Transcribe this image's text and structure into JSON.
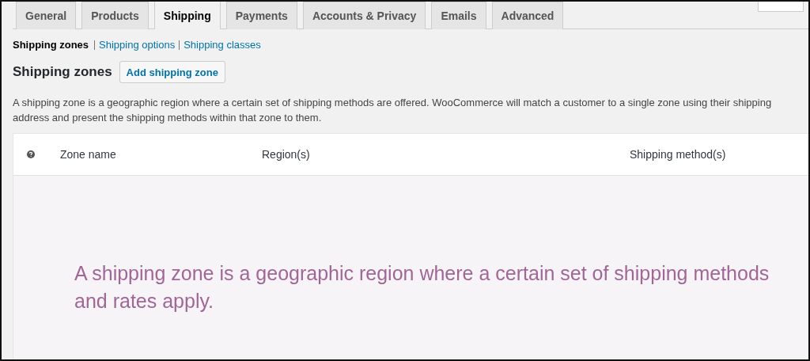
{
  "tabs": [
    {
      "label": "General",
      "selected": false
    },
    {
      "label": "Products",
      "selected": false
    },
    {
      "label": "Shipping",
      "selected": true
    },
    {
      "label": "Payments",
      "selected": false
    },
    {
      "label": "Accounts & Privacy",
      "selected": false
    },
    {
      "label": "Emails",
      "selected": false
    },
    {
      "label": "Advanced",
      "selected": false
    }
  ],
  "subnav": [
    {
      "label": "Shipping zones",
      "selected": true
    },
    {
      "label": "Shipping options",
      "selected": false
    },
    {
      "label": "Shipping classes",
      "selected": false
    }
  ],
  "heading": "Shipping zones",
  "add_button": "Add shipping zone",
  "description": "A shipping zone is a geographic region where a certain set of shipping methods are offered. WooCommerce will match a customer to a single zone using their shipping\naddress and present the shipping methods within that zone to them.",
  "table": {
    "columns": [
      "Zone name",
      "Region(s)",
      "Shipping method(s)"
    ],
    "empty_message": "A shipping zone is a geographic region where a certain set of shipping methods and rates apply."
  }
}
